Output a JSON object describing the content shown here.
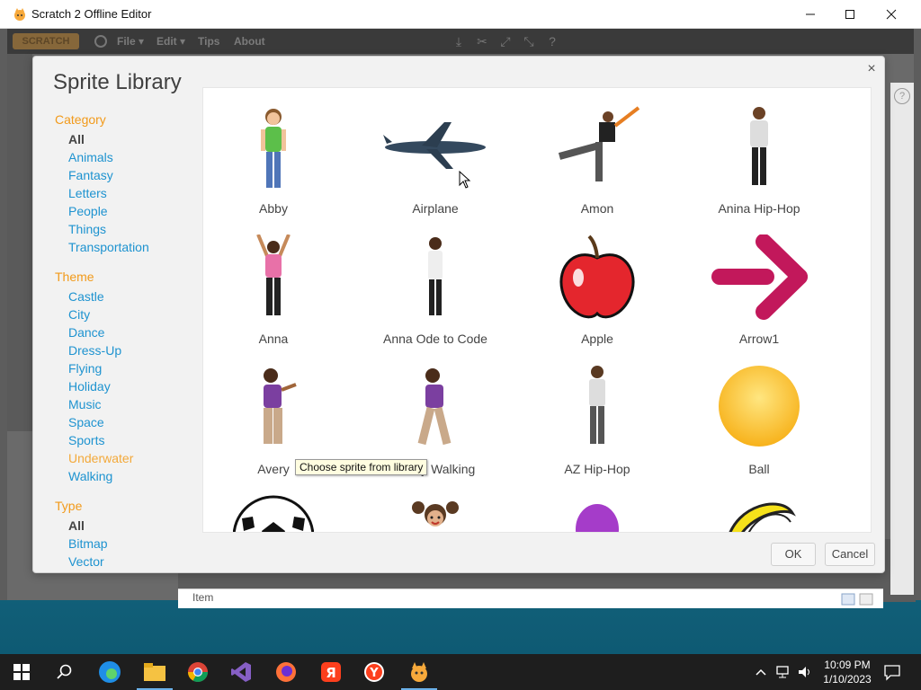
{
  "window": {
    "title": "Scratch 2 Offline Editor",
    "minimize": "—",
    "maximize": "☐",
    "close": "✕"
  },
  "menubar": {
    "logo": "SCRATCH",
    "items": [
      "File ▾",
      "Edit ▾",
      "Tips",
      "About"
    ]
  },
  "dialog": {
    "title": "Sprite Library",
    "close": "×",
    "ok_label": "OK",
    "cancel_label": "Cancel",
    "tooltip": "Choose sprite from library"
  },
  "sidebar": {
    "category_heading": "Category",
    "category_items": [
      "All",
      "Animals",
      "Fantasy",
      "Letters",
      "People",
      "Things",
      "Transportation"
    ],
    "theme_heading": "Theme",
    "theme_items": [
      "Castle",
      "City",
      "Dance",
      "Dress-Up",
      "Flying",
      "Holiday",
      "Music",
      "Space",
      "Sports",
      "Underwater",
      "Walking"
    ],
    "type_heading": "Type",
    "type_items": [
      "All",
      "Bitmap",
      "Vector"
    ]
  },
  "sprites": [
    {
      "label": "Abby",
      "icon": "girl-green-shirt"
    },
    {
      "label": "Airplane",
      "icon": "airplane"
    },
    {
      "label": "Amon",
      "icon": "dancer-kick"
    },
    {
      "label": "Anina Hip-Hop",
      "icon": "hip-hop-dancer"
    },
    {
      "label": "Anna",
      "icon": "girl-arms-up"
    },
    {
      "label": "Anna Ode to Code",
      "icon": "girl-standing"
    },
    {
      "label": "Apple",
      "icon": "apple"
    },
    {
      "label": "Arrow1",
      "icon": "arrow"
    },
    {
      "label": "Avery",
      "icon": "girl-purple-pose"
    },
    {
      "label": "Avery Walking",
      "icon": "girl-purple-walking"
    },
    {
      "label": "AZ Hip-Hop",
      "icon": "boy-hip-hop"
    },
    {
      "label": "Ball",
      "icon": "yellow-ball"
    },
    {
      "label": "",
      "icon": "soccer-ball"
    },
    {
      "label": "",
      "icon": "girl-pigtails"
    },
    {
      "label": "",
      "icon": "purple-balloon"
    },
    {
      "label": "",
      "icon": "bananas"
    }
  ],
  "editor": {
    "item_label": "Item"
  },
  "taskbar": {
    "time": "10:09 PM",
    "date": "1/10/2023",
    "icons": [
      "windows-start-icon",
      "search-icon",
      "edge-icon",
      "file-explorer-icon",
      "chrome-icon",
      "visual-studio-icon",
      "firefox-icon",
      "yandex-browser-icon",
      "yandex-icon",
      "scratch-icon"
    ]
  },
  "colors": {
    "category_heading": "#f29a1a",
    "link": "#1e93d0",
    "selected": "#444444"
  }
}
